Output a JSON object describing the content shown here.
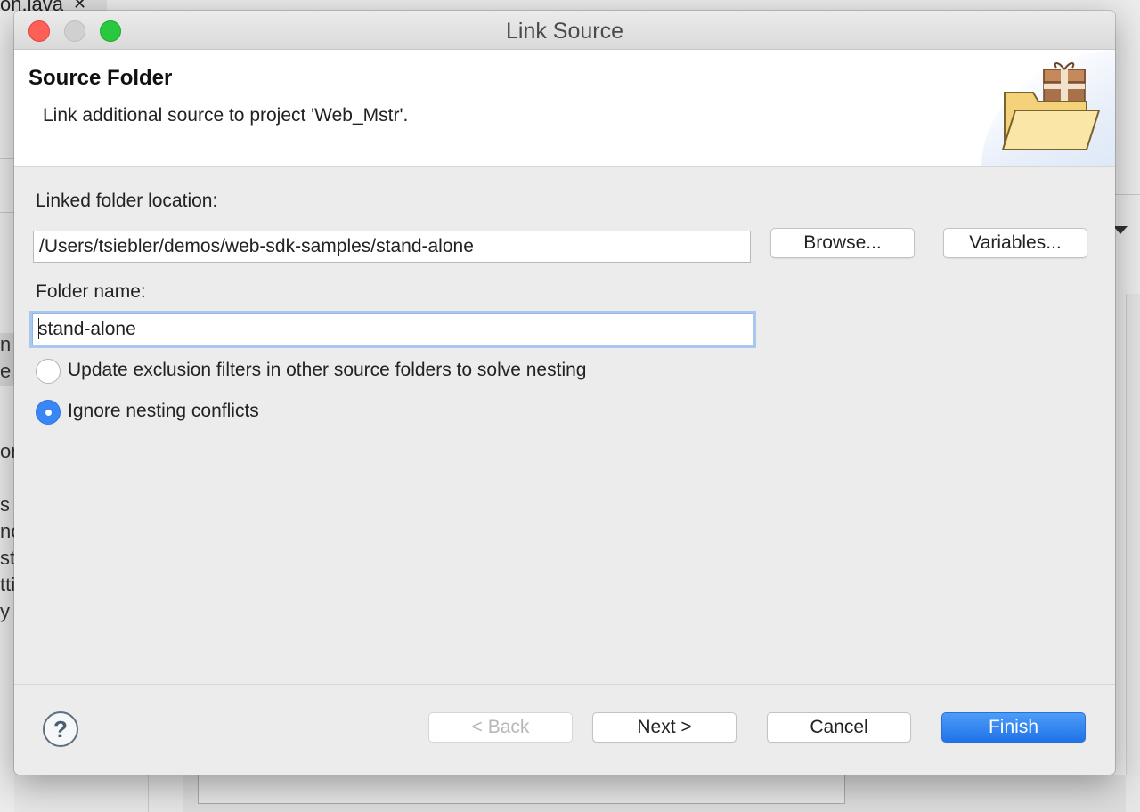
{
  "background": {
    "editor_tab_label": "on.java",
    "sidebar_fragments": [
      "n",
      "e",
      "or",
      "s",
      "nc",
      "ste",
      "tti",
      "y"
    ]
  },
  "dialog": {
    "title": "Link Source",
    "header": {
      "title": "Source Folder",
      "description": "Link additional source to project 'Web_Mstr'."
    },
    "linked_folder": {
      "label": "Linked folder location:",
      "value": "/Users/tsiebler/demos/web-sdk-samples/stand-alone",
      "browse_label": "Browse...",
      "variables_label": "Variables..."
    },
    "folder_name": {
      "label": "Folder name:",
      "value": "stand-alone"
    },
    "options": [
      {
        "label": "Update exclusion filters in other source folders to solve nesting",
        "checked": false
      },
      {
        "label": "Ignore nesting conflicts",
        "checked": true
      }
    ],
    "footer": {
      "back_label": "< Back",
      "next_label": "Next >",
      "cancel_label": "Cancel",
      "finish_label": "Finish"
    },
    "icons": {
      "help": "help-icon",
      "header": "folder-package-icon"
    },
    "colors": {
      "accent": "#3b86f5",
      "primary_button": "#1f73e8",
      "close": "#fe5f57",
      "maximize": "#28c840"
    }
  }
}
